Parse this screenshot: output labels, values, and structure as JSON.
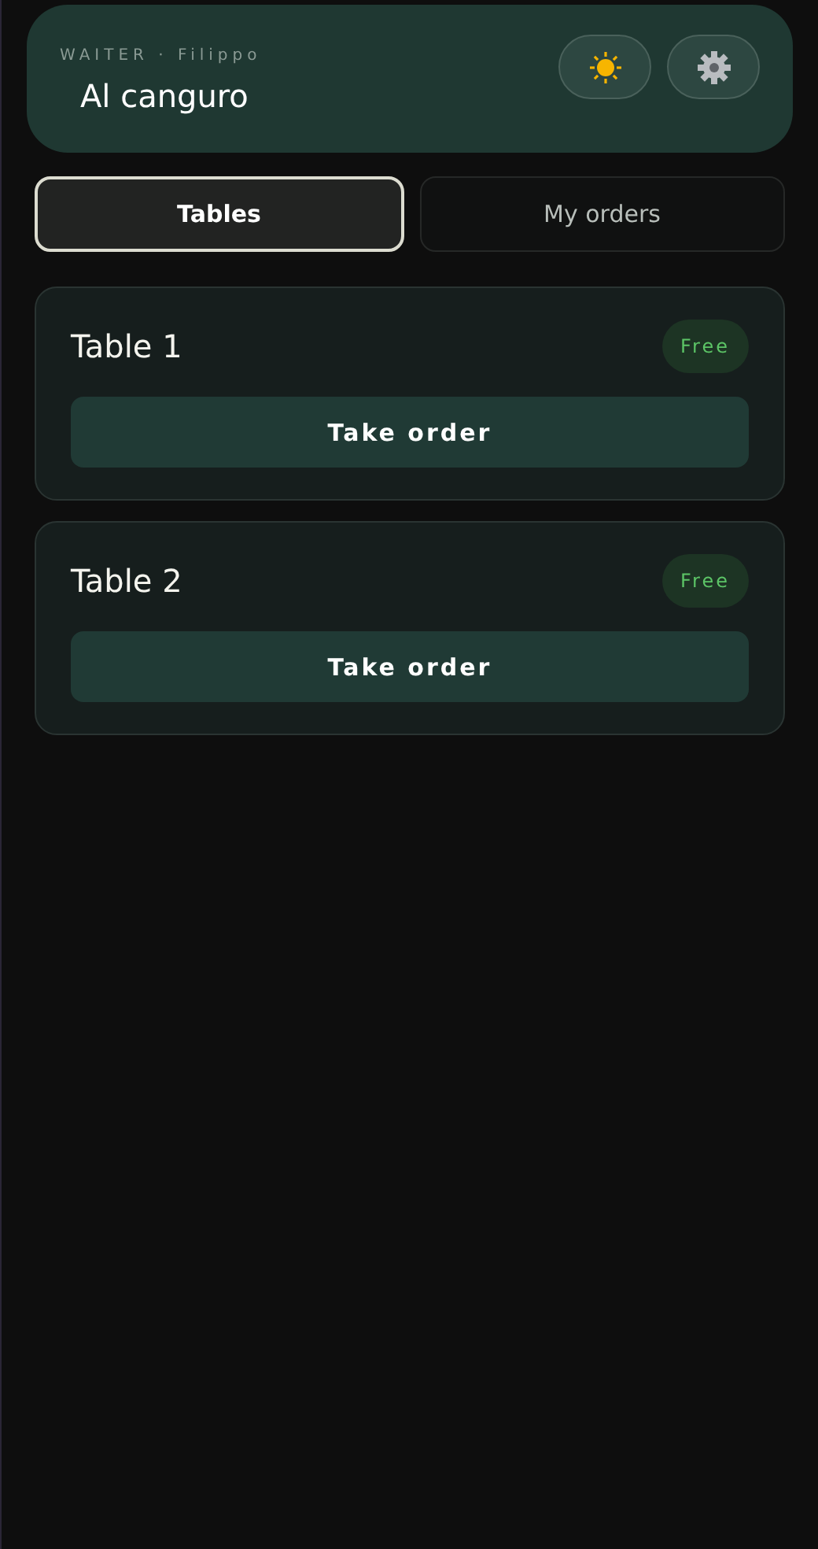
{
  "header": {
    "role_line": "WAITER · Filippo",
    "restaurant": "Al canguro"
  },
  "tabs": [
    {
      "label": "Tables",
      "selected": true
    },
    {
      "label": "My orders",
      "selected": false
    }
  ],
  "tables": [
    {
      "name": "Table 1",
      "status": "Free",
      "action": "Take order"
    },
    {
      "name": "Table 2",
      "status": "Free",
      "action": "Take order"
    }
  ]
}
